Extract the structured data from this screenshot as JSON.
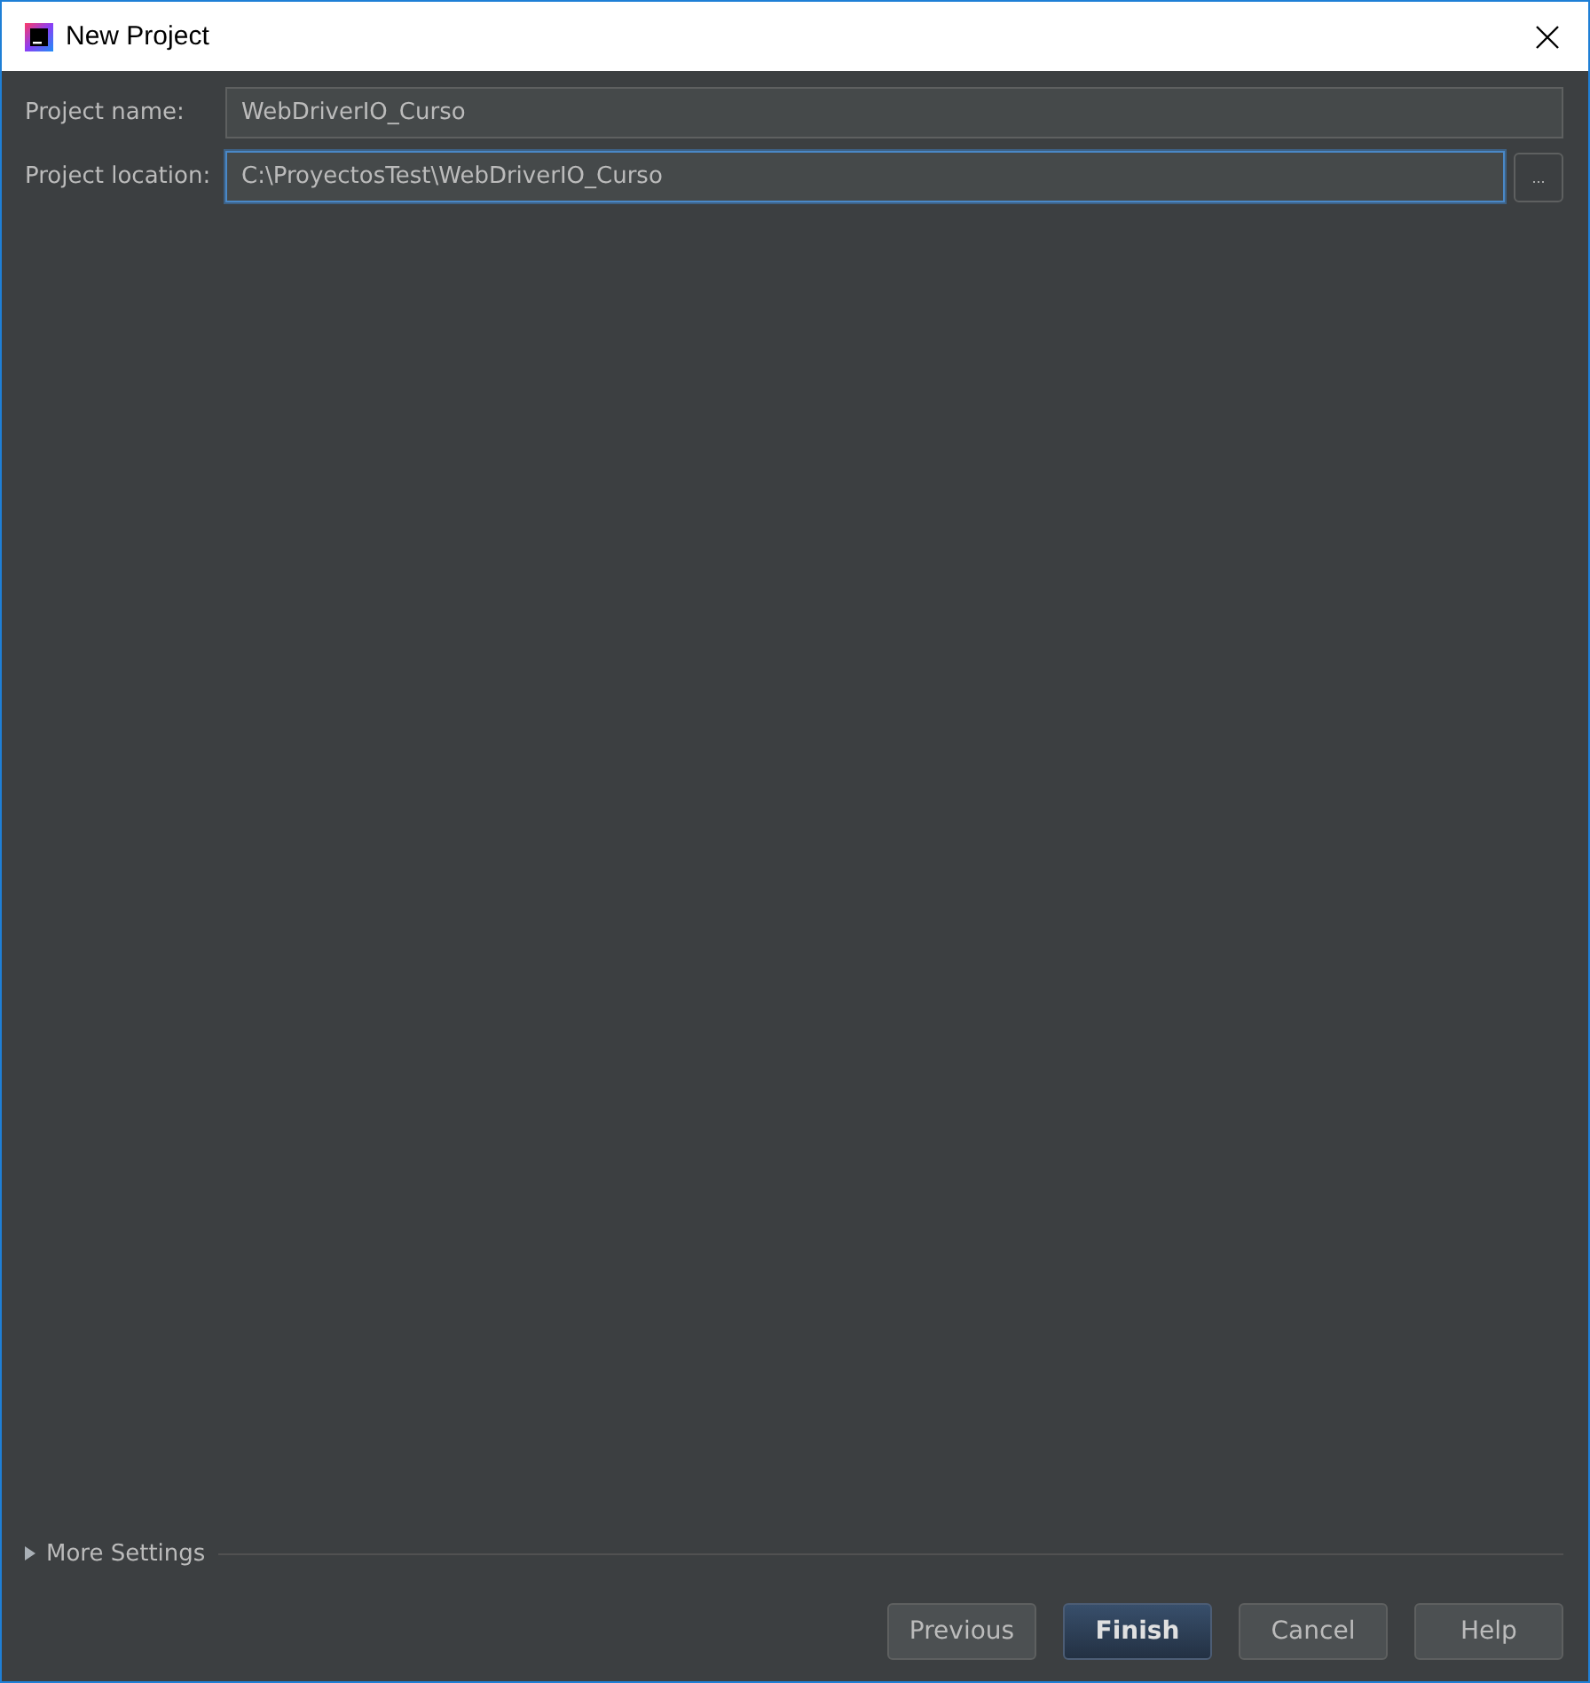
{
  "window": {
    "title": "New Project"
  },
  "fields": [
    {
      "label": "Project name:",
      "value": "WebDriverIO_Curso",
      "focused": false,
      "browse": false
    },
    {
      "label": "Project location:",
      "value": "C:\\ProyectosTest\\WebDriverIO_Curso",
      "focused": true,
      "browse": true,
      "browse_label": "..."
    }
  ],
  "more_settings": {
    "label": "More Settings",
    "expanded": false
  },
  "buttons": [
    {
      "label": "Previous",
      "kind": "normal"
    },
    {
      "label": "Finish",
      "kind": "default"
    },
    {
      "label": "Cancel",
      "kind": "normal"
    },
    {
      "label": "Help",
      "kind": "normal"
    }
  ]
}
